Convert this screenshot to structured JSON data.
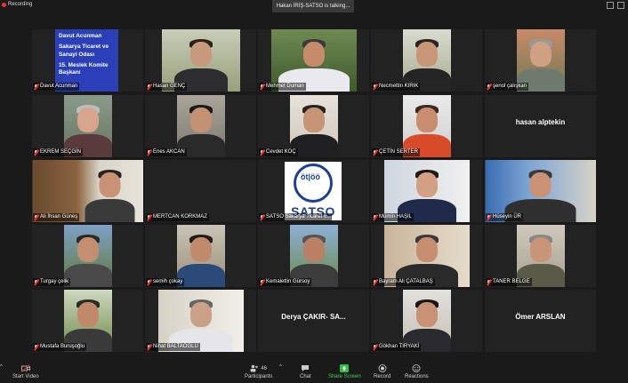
{
  "top": {
    "recording_label": "Recording",
    "talking_label": "Hakan İRİŞ-SATSO is talking..."
  },
  "slide": {
    "line1": "Davut Acunman",
    "line2": "Sakarya Ticaret ve Sanayi Odası",
    "line3": "15. Meslek Komite Başkanı"
  },
  "satso_logo_text": "SATSO",
  "tiles": [
    {
      "name": "Davut Acunman"
    },
    {
      "name": "Hasan GENÇ"
    },
    {
      "name": "Mehmet Duman"
    },
    {
      "name": "Necmettin KIRIK"
    },
    {
      "name": "şenol çalışkan"
    },
    {
      "name": "EKREM SEÇGİN"
    },
    {
      "name": "Enes AKCAN"
    },
    {
      "name": "Cevdet KOÇ"
    },
    {
      "name": "ÇETİN SERTER"
    },
    {
      "name": "hasan alptekin",
      "big": "hasan alptekin"
    },
    {
      "name": "Ali İhsan Güneş"
    },
    {
      "name": "MERTCAN KORKMAZ"
    },
    {
      "name": "SATSO Sakarya Ticaret v..."
    },
    {
      "name": "Mümin HAŞIL"
    },
    {
      "name": "Hüseyin ÜR"
    },
    {
      "name": "Turgay çelik"
    },
    {
      "name": "semih çokay"
    },
    {
      "name": "Kemalettin Gürsoy"
    },
    {
      "name": "Bayram Ali ÇATALBAŞ"
    },
    {
      "name": "TANER BELGE"
    },
    {
      "name": "Mustafa Buruşoğlu"
    },
    {
      "name": "Nihat BALTAOĞLU"
    },
    {
      "name": "Derya ÇAKIR- SA...",
      "big": "Derya ÇAKIR- SA..."
    },
    {
      "name": "Gökhan TIRYAKİ"
    },
    {
      "name": "Ömer ARSLAN",
      "big": "Ömer ARSLAN"
    }
  ],
  "toolbar": {
    "start_video": "Start Video",
    "participants": "Participants",
    "participants_count": "46",
    "chat": "Chat",
    "share_screen": "Share Screen",
    "record": "Record",
    "reactions": "Reactions"
  }
}
